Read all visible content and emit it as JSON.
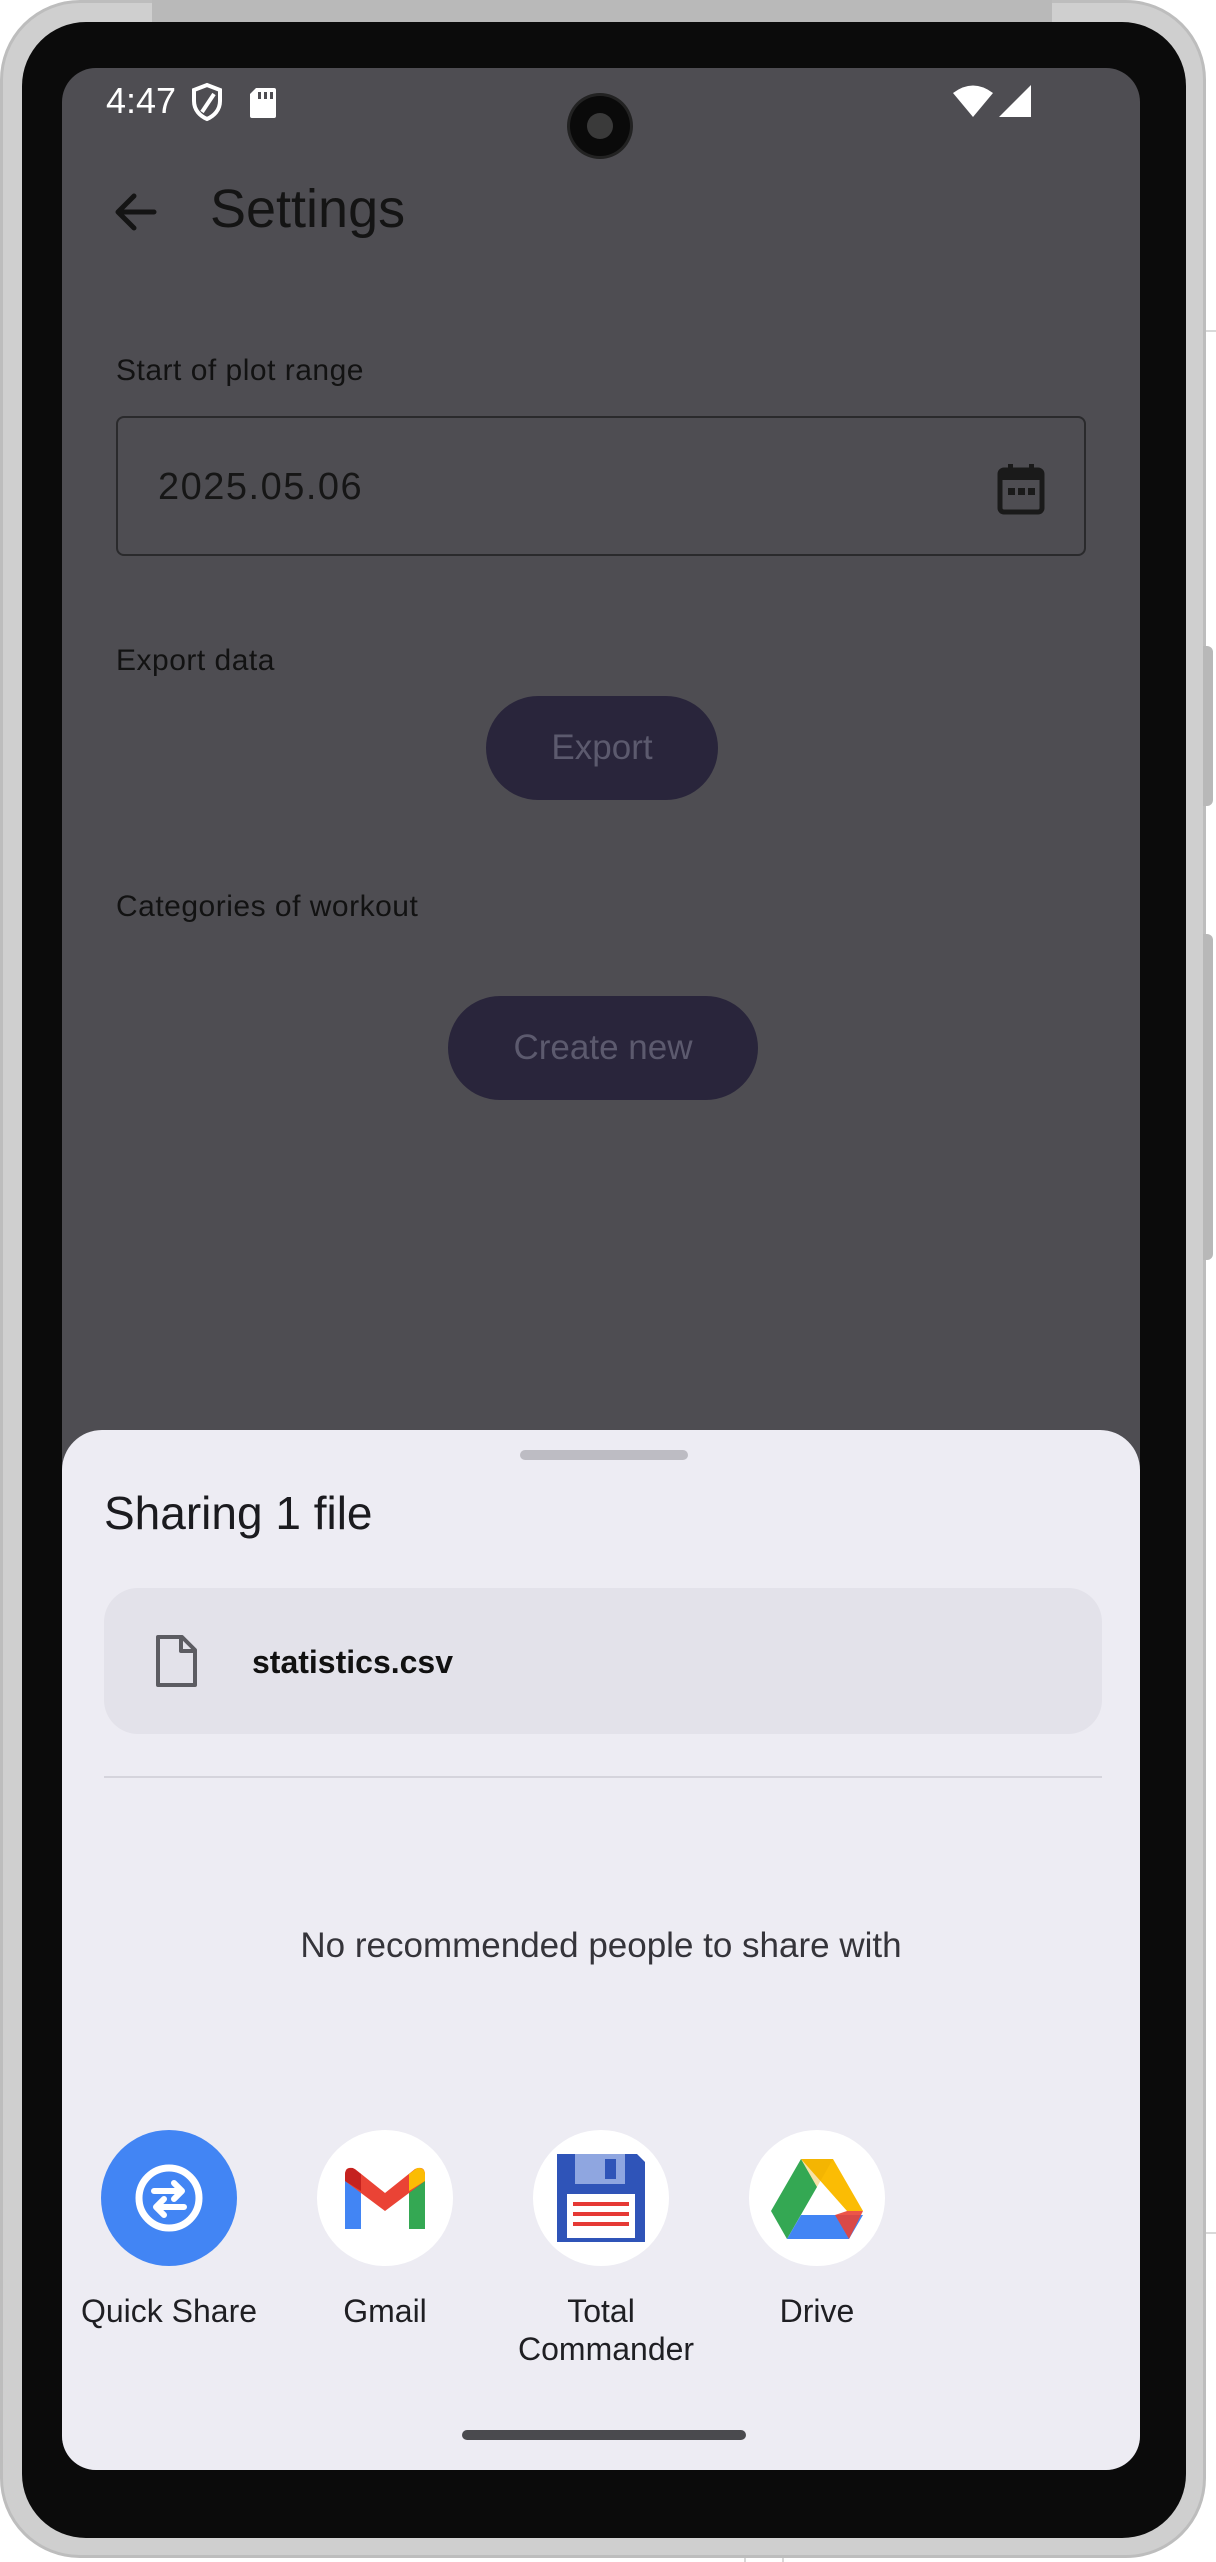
{
  "status_bar": {
    "time": "4:47"
  },
  "app_bar": {
    "title": "Settings"
  },
  "settings": {
    "plot_range_label": "Start of plot range",
    "plot_range_value": "2025.05.06",
    "export_label": "Export data",
    "export_button": "Export",
    "categories_label": "Categories of workout",
    "create_new_button": "Create new"
  },
  "share_sheet": {
    "title": "Sharing 1 file",
    "file_name": "statistics.csv",
    "no_people": "No recommended people to share with",
    "apps": [
      {
        "label": "Quick Share",
        "icon": "quick-share-icon"
      },
      {
        "label": "Gmail",
        "icon": "gmail-icon"
      },
      {
        "label": "Total Commander",
        "icon": "total-commander-icon"
      },
      {
        "label": "Drive",
        "icon": "drive-icon"
      }
    ]
  },
  "colors": {
    "scrim": "#4e4d52",
    "sheet": "#edecf3",
    "pill_button": "#29253b",
    "quick_share_blue": "#4285f4"
  }
}
